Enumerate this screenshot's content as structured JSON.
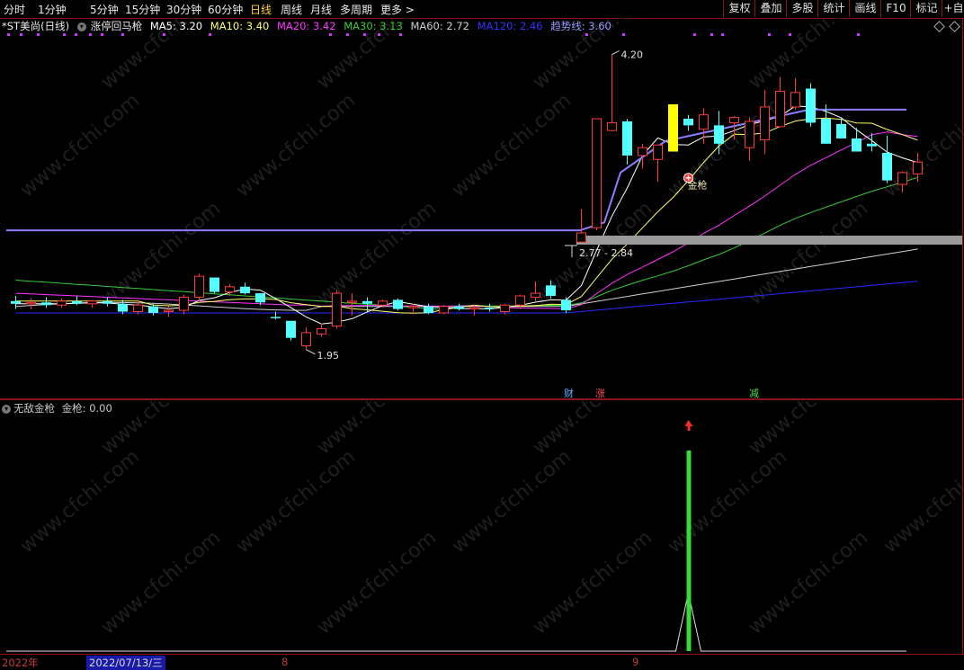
{
  "toolbar": {
    "periods": [
      "分时",
      "1分钟",
      "5分钟",
      "15分钟",
      "30分钟",
      "60分钟",
      "日线",
      "周线",
      "月线",
      "多周期",
      "更多 >"
    ],
    "active": "日线",
    "right_buttons": [
      "复权",
      "叠加",
      "多股",
      "统计",
      "画线",
      "F10",
      "标记",
      "+自"
    ]
  },
  "info": {
    "stock": "*ST美尚",
    "period": "(日线)",
    "indicator": "涨停回马枪",
    "ma5": {
      "label": "MA5:",
      "value": "3.20",
      "color": "#ffffff"
    },
    "ma10": {
      "label": "MA10:",
      "value": "3.40",
      "color": "#ffff66"
    },
    "ma20": {
      "label": "MA20:",
      "value": "3.42",
      "color": "#ff33ff"
    },
    "ma30": {
      "label": "MA30:",
      "value": "3.13",
      "color": "#33cc33"
    },
    "ma60": {
      "label": "MA60:",
      "value": "2.72",
      "color": "#cccccc"
    },
    "ma120": {
      "label": "MA120:",
      "value": "2.46",
      "color": "#3333ff"
    },
    "trend": {
      "label": "趋势线:",
      "value": "3.60",
      "color": "#9999ff"
    }
  },
  "annotations": {
    "high": "4.20",
    "low": "1.95",
    "range": "2.77 - 2.84",
    "signal": "金枪",
    "events": [
      "财",
      "涨",
      "减"
    ]
  },
  "indicator_pane": {
    "name": "无敌金枪",
    "series_label": "金枪:",
    "value": "0.00"
  },
  "dates": {
    "year": "2022年",
    "cursor": "2022/07/13/三",
    "month8": "8",
    "month9": "9"
  },
  "watermark": "www.cfchi.com",
  "colors": {
    "up": "#ff3c3c",
    "down": "#54ffff",
    "limit_up": "#ffff00",
    "signal_bar": "#33dd33",
    "grid_sep": "#8b1414"
  },
  "chart_data": {
    "type": "candlestick",
    "ylim": [
      1.75,
      4.3
    ],
    "candles": [
      {
        "o": 2.32,
        "h": 2.36,
        "l": 2.26,
        "c": 2.3
      },
      {
        "o": 2.3,
        "h": 2.34,
        "l": 2.26,
        "c": 2.31
      },
      {
        "o": 2.31,
        "h": 2.35,
        "l": 2.27,
        "c": 2.29
      },
      {
        "o": 2.29,
        "h": 2.34,
        "l": 2.27,
        "c": 2.32
      },
      {
        "o": 2.32,
        "h": 2.36,
        "l": 2.29,
        "c": 2.3
      },
      {
        "o": 2.3,
        "h": 2.33,
        "l": 2.27,
        "c": 2.32
      },
      {
        "o": 2.32,
        "h": 2.35,
        "l": 2.28,
        "c": 2.3
      },
      {
        "o": 2.3,
        "h": 2.33,
        "l": 2.22,
        "c": 2.24
      },
      {
        "o": 2.24,
        "h": 2.33,
        "l": 2.22,
        "c": 2.29
      },
      {
        "o": 2.28,
        "h": 2.3,
        "l": 2.21,
        "c": 2.23
      },
      {
        "o": 2.24,
        "h": 2.28,
        "l": 2.2,
        "c": 2.25
      },
      {
        "o": 2.25,
        "h": 2.37,
        "l": 2.22,
        "c": 2.35
      },
      {
        "o": 2.35,
        "h": 2.53,
        "l": 2.32,
        "c": 2.51
      },
      {
        "o": 2.5,
        "h": 2.5,
        "l": 2.38,
        "c": 2.39
      },
      {
        "o": 2.39,
        "h": 2.45,
        "l": 2.36,
        "c": 2.43
      },
      {
        "o": 2.43,
        "h": 2.46,
        "l": 2.37,
        "c": 2.38
      },
      {
        "o": 2.38,
        "h": 2.38,
        "l": 2.29,
        "c": 2.31
      },
      {
        "o": 2.2,
        "h": 2.24,
        "l": 2.18,
        "c": 2.19
      },
      {
        "o": 2.17,
        "h": 2.17,
        "l": 2.02,
        "c": 2.04
      },
      {
        "o": 1.98,
        "h": 2.12,
        "l": 1.95,
        "c": 2.08
      },
      {
        "o": 2.07,
        "h": 2.15,
        "l": 2.05,
        "c": 2.11
      },
      {
        "o": 2.13,
        "h": 2.4,
        "l": 2.11,
        "c": 2.38
      },
      {
        "o": 2.31,
        "h": 2.38,
        "l": 2.21,
        "c": 2.32
      },
      {
        "o": 2.32,
        "h": 2.35,
        "l": 2.24,
        "c": 2.3
      },
      {
        "o": 2.29,
        "h": 2.33,
        "l": 2.27,
        "c": 2.32
      },
      {
        "o": 2.33,
        "h": 2.34,
        "l": 2.25,
        "c": 2.26
      },
      {
        "o": 2.27,
        "h": 2.3,
        "l": 2.22,
        "c": 2.28
      },
      {
        "o": 2.28,
        "h": 2.3,
        "l": 2.22,
        "c": 2.23
      },
      {
        "o": 2.23,
        "h": 2.29,
        "l": 2.22,
        "c": 2.28
      },
      {
        "o": 2.28,
        "h": 2.3,
        "l": 2.25,
        "c": 2.26
      },
      {
        "o": 2.26,
        "h": 2.29,
        "l": 2.21,
        "c": 2.27
      },
      {
        "o": 2.27,
        "h": 2.3,
        "l": 2.24,
        "c": 2.26
      },
      {
        "o": 2.24,
        "h": 2.3,
        "l": 2.22,
        "c": 2.29
      },
      {
        "o": 2.29,
        "h": 2.37,
        "l": 2.26,
        "c": 2.36
      },
      {
        "o": 2.35,
        "h": 2.47,
        "l": 2.32,
        "c": 2.38
      },
      {
        "o": 2.44,
        "h": 2.48,
        "l": 2.34,
        "c": 2.36
      },
      {
        "o": 2.33,
        "h": 2.35,
        "l": 2.23,
        "c": 2.25
      },
      {
        "o": 2.77,
        "h": 3.02,
        "l": 2.77,
        "c": 2.84
      },
      {
        "o": 2.88,
        "h": 3.71,
        "l": 2.86,
        "c": 3.71
      },
      {
        "o": 3.62,
        "h": 4.2,
        "l": 3.62,
        "c": 3.68
      },
      {
        "o": 3.69,
        "h": 3.71,
        "l": 3.36,
        "c": 3.43
      },
      {
        "o": 3.43,
        "h": 3.52,
        "l": 3.33,
        "c": 3.49
      },
      {
        "o": 3.4,
        "h": 3.51,
        "l": 3.23,
        "c": 3.51
      },
      {
        "o": 3.82,
        "h": 3.82,
        "l": 3.46,
        "c": 3.46
      },
      {
        "o": 3.71,
        "h": 3.74,
        "l": 3.62,
        "c": 3.66
      },
      {
        "o": 3.63,
        "h": 3.79,
        "l": 3.52,
        "c": 3.74
      },
      {
        "o": 3.66,
        "h": 3.77,
        "l": 3.44,
        "c": 3.52
      },
      {
        "o": 3.68,
        "h": 3.73,
        "l": 3.55,
        "c": 3.72
      },
      {
        "o": 3.49,
        "h": 3.72,
        "l": 3.39,
        "c": 3.69
      },
      {
        "o": 3.55,
        "h": 3.93,
        "l": 3.44,
        "c": 3.8
      },
      {
        "o": 3.65,
        "h": 4.03,
        "l": 3.65,
        "c": 3.92
      },
      {
        "o": 3.8,
        "h": 4.02,
        "l": 3.78,
        "c": 3.91
      },
      {
        "o": 3.94,
        "h": 3.98,
        "l": 3.65,
        "c": 3.68
      },
      {
        "o": 3.71,
        "h": 3.82,
        "l": 3.52,
        "c": 3.52
      },
      {
        "o": 3.67,
        "h": 3.72,
        "l": 3.58,
        "c": 3.56
      },
      {
        "o": 3.56,
        "h": 3.64,
        "l": 3.48,
        "c": 3.46
      },
      {
        "o": 3.52,
        "h": 3.6,
        "l": 3.46,
        "c": 3.5
      },
      {
        "o": 3.45,
        "h": 3.58,
        "l": 3.22,
        "c": 3.24
      },
      {
        "o": 3.21,
        "h": 3.31,
        "l": 3.15,
        "c": 3.3
      },
      {
        "o": 3.29,
        "h": 3.45,
        "l": 3.23,
        "c": 3.38
      }
    ],
    "signal": {
      "index": 44,
      "value": 1.0
    }
  }
}
